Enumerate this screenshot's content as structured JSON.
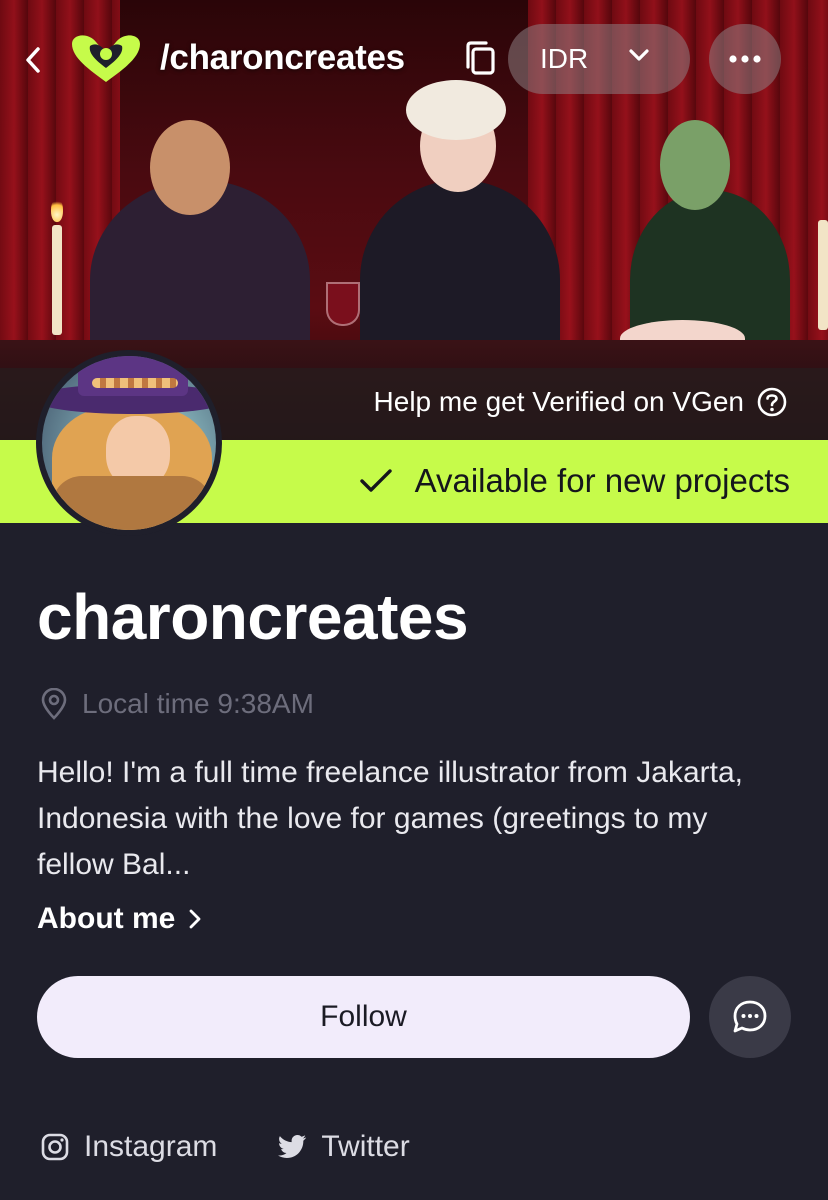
{
  "header": {
    "handle": "/charoncreates",
    "currency": "IDR"
  },
  "banner": {
    "verify_text": "Help me get Verified on VGen",
    "availability_text": "Available for new projects"
  },
  "profile": {
    "username": "charoncreates",
    "local_time": "Local time 9:38AM",
    "bio": "Hello! I'm a full time freelance illustrator from Jakarta, Indonesia with the love for games (greetings to my fellow Bal...",
    "about_label": "About me"
  },
  "actions": {
    "follow_label": "Follow"
  },
  "socials": [
    {
      "label": "Instagram",
      "icon": "instagram-icon"
    },
    {
      "label": "Twitter",
      "icon": "twitter-icon"
    }
  ],
  "colors": {
    "accent": "#c6fb4a",
    "background": "#1f1f2b",
    "follow_bg": "#f2ecfb",
    "muted_text": "#6d6d7c"
  }
}
